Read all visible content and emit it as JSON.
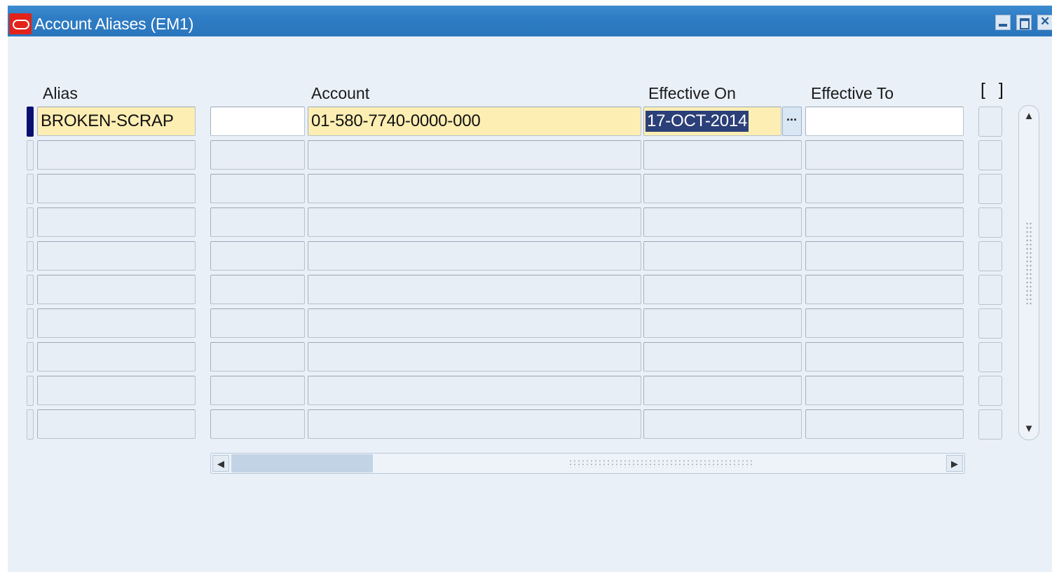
{
  "window": {
    "title": "Account Aliases (EM1)",
    "title_bar_color": "#2e7cc4",
    "logo_icon": "oracle-logo-icon",
    "controls": [
      "minimize-icon",
      "maximize-icon",
      "close-icon"
    ]
  },
  "columns": {
    "alias": "Alias",
    "account": "Account",
    "effective_on": "Effective On",
    "effective_to": "Effective To",
    "dff": "[ ]"
  },
  "rows": [
    {
      "alias": "BROKEN-SCRAP",
      "description": "",
      "account": "01-580-7740-0000-000",
      "effective_on": "17-OCT-2014",
      "effective_to": ""
    },
    {
      "alias": "",
      "description": "",
      "account": "",
      "effective_on": "",
      "effective_to": ""
    },
    {
      "alias": "",
      "description": "",
      "account": "",
      "effective_on": "",
      "effective_to": ""
    },
    {
      "alias": "",
      "description": "",
      "account": "",
      "effective_on": "",
      "effective_to": ""
    },
    {
      "alias": "",
      "description": "",
      "account": "",
      "effective_on": "",
      "effective_to": ""
    },
    {
      "alias": "",
      "description": "",
      "account": "",
      "effective_on": "",
      "effective_to": ""
    },
    {
      "alias": "",
      "description": "",
      "account": "",
      "effective_on": "",
      "effective_to": ""
    },
    {
      "alias": "",
      "description": "",
      "account": "",
      "effective_on": "",
      "effective_to": ""
    },
    {
      "alias": "",
      "description": "",
      "account": "",
      "effective_on": "",
      "effective_to": ""
    },
    {
      "alias": "",
      "description": "",
      "account": "",
      "effective_on": "",
      "effective_to": ""
    }
  ],
  "lov_button_icon": "ellipsis-icon",
  "colors": {
    "required_field": "#fdeeb3",
    "selection": "#2b3f78",
    "current_record_indicator": "#0a1070"
  }
}
